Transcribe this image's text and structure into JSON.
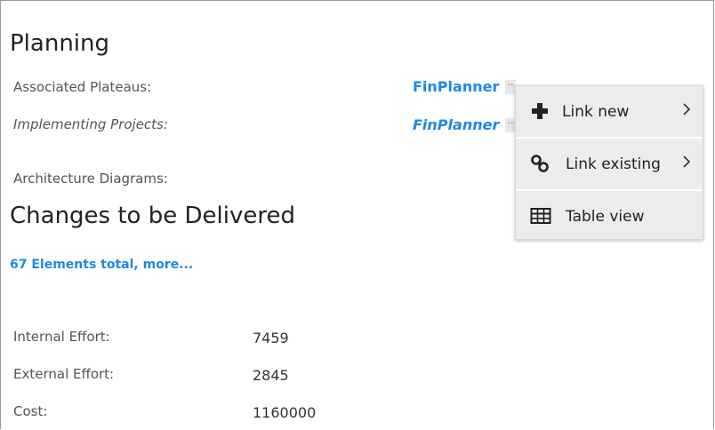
{
  "planning": {
    "title": "Planning",
    "associated_plateaus_label": "Associated Plateaus:",
    "associated_plateaus_link": "FinPlanner",
    "implementing_projects_label": "Implementing Projects:",
    "implementing_projects_link": "FinPlanner",
    "architecture_diagrams_label": "Architecture Diagrams:",
    "more_button": "··"
  },
  "changes": {
    "title": "Changes to be Delivered",
    "elements_link": "67 Elements total, more..."
  },
  "metrics": [
    {
      "label": "Internal Effort:",
      "value": "7459"
    },
    {
      "label": "External Effort:",
      "value": "2845"
    },
    {
      "label": "Cost:",
      "value": "1160000"
    }
  ],
  "context_menu": {
    "items": [
      {
        "label": "Link new",
        "icon": "plus-icon",
        "has_submenu": true
      },
      {
        "label": "Link existing",
        "icon": "link-icon",
        "has_submenu": true
      },
      {
        "label": "Table view",
        "icon": "table-icon",
        "has_submenu": false
      }
    ]
  },
  "colors": {
    "link": "#1e88e5",
    "menu_bg": "#ececec",
    "text": "#333333"
  }
}
